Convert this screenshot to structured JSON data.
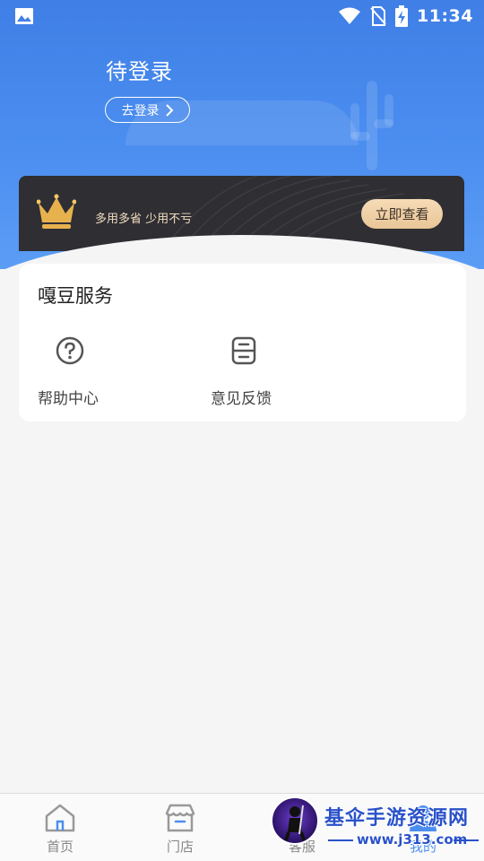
{
  "status_bar": {
    "time": "11:34",
    "icons": [
      "image-icon",
      "wifi-icon",
      "no-sim-icon",
      "battery-charging-icon"
    ]
  },
  "header": {
    "login_status": "待登录",
    "login_button": "去登录",
    "gradient_top": "#3f7fe6",
    "gradient_bottom": "#5b9df5"
  },
  "vip_banner": {
    "slogan": "多用多省 少用不亏",
    "action_button": "立即查看",
    "icon": "crown-icon",
    "background": "#2f2e33",
    "accent": "#e9c597"
  },
  "services": {
    "title": "嘎豆服务",
    "items": [
      {
        "label": "帮助中心",
        "icon": "help-circle-icon"
      },
      {
        "label": "意见反馈",
        "icon": "feedback-icon"
      }
    ]
  },
  "tab_bar": {
    "tabs": [
      {
        "label": "首页",
        "icon": "home-icon"
      },
      {
        "label": "门店",
        "icon": "store-icon"
      },
      {
        "label": "客服",
        "icon": "customer-service-icon"
      },
      {
        "label": "我的",
        "icon": "profile-icon",
        "active": true
      }
    ],
    "active_color": "#4b8ef0"
  },
  "watermark": {
    "title": "基伞手游资源网",
    "url": "www.j313.com"
  }
}
